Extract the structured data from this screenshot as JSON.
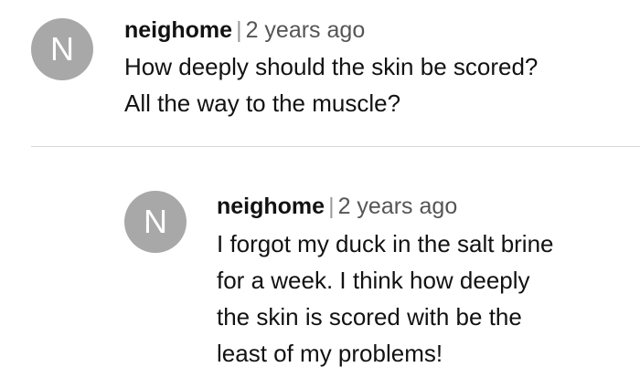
{
  "comments": [
    {
      "avatar_initial": "N",
      "username": "neighome",
      "separator": "|",
      "timestamp": "2 years ago",
      "body_lines": [
        "How deeply should the skin be scored?",
        "All the way to the muscle?"
      ]
    },
    {
      "avatar_initial": "N",
      "username": "neighome",
      "separator": "|",
      "timestamp": "2 years ago",
      "body_lines": [
        "I forgot my duck in the salt brine",
        "for a week.  I think how deeply",
        "the skin is scored with be the",
        "least of my problems!"
      ]
    }
  ],
  "colors": {
    "avatar_bg": "#a8a8a8",
    "text": "#121212",
    "meta_muted": "#555555",
    "divider": "#d8d8d8"
  }
}
